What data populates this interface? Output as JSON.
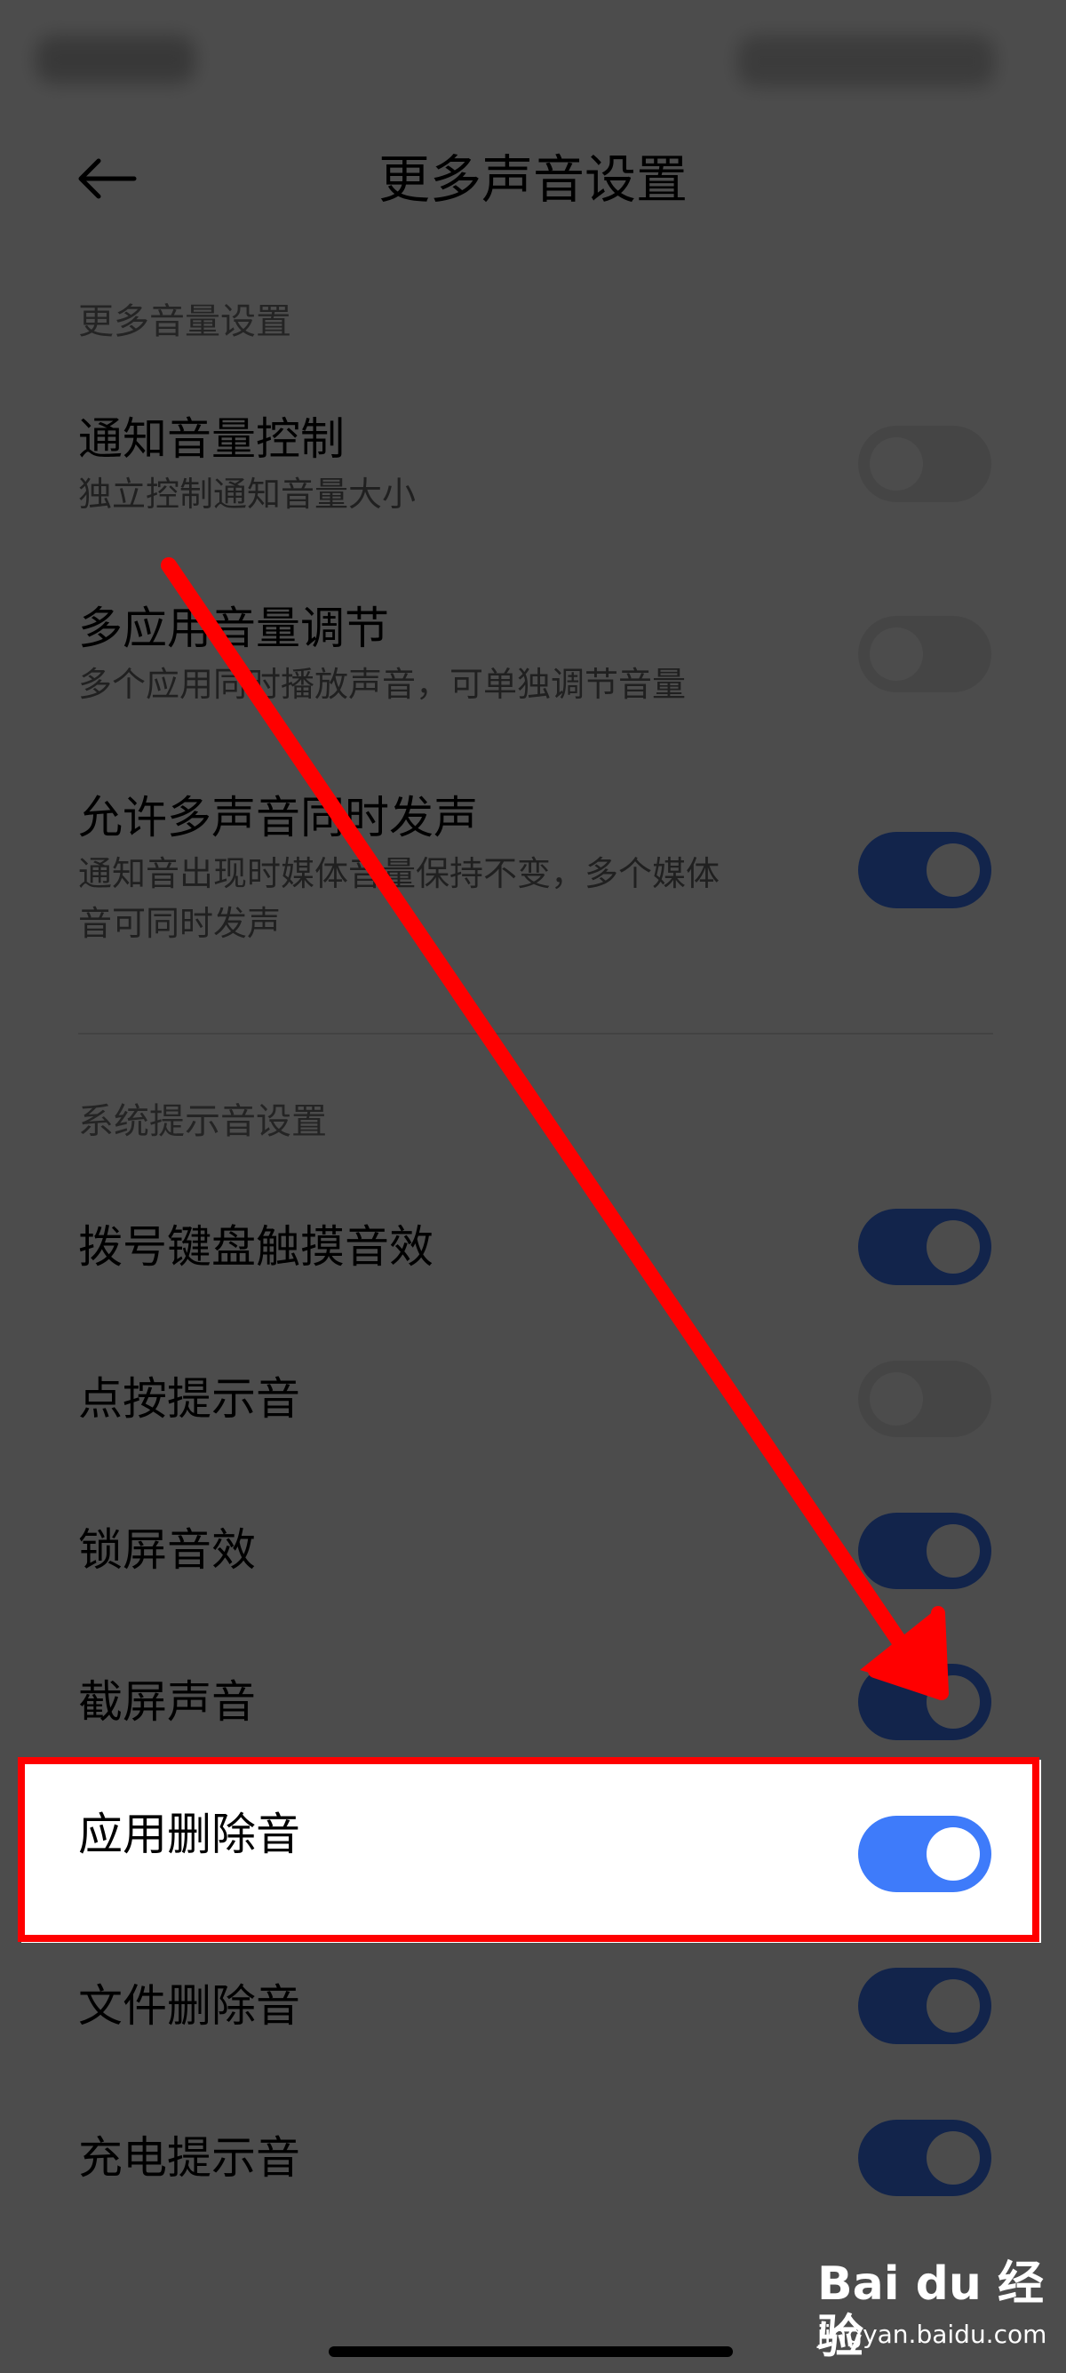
{
  "header": {
    "title": "更多声音设置"
  },
  "sections": {
    "volume": {
      "label": "更多音量设置"
    },
    "system": {
      "label": "系统提示音设置"
    }
  },
  "volume_items": [
    {
      "title": "通知音量控制",
      "subtitle": "独立控制通知音量大小",
      "on": false
    },
    {
      "title": "多应用音量调节",
      "subtitle": "多个应用同时播放声音，可单独调节音量",
      "on": false
    },
    {
      "title": "允许多声音同时发声",
      "subtitle_line1": "通知音出现时媒体音量保持不变，多个媒体",
      "subtitle_line2": "音可同时发声",
      "on": true
    }
  ],
  "system_items": [
    {
      "title": "拨号键盘触摸音效",
      "on": true
    },
    {
      "title": "点按提示音",
      "on": false
    },
    {
      "title": "锁屏音效",
      "on": true
    },
    {
      "title": "截屏声音",
      "on": true
    },
    {
      "title": "应用删除音",
      "on": true
    },
    {
      "title": "文件删除音",
      "on": true
    },
    {
      "title": "充电提示音",
      "on": true
    }
  ],
  "icons": {
    "back": "back-arrow-icon"
  },
  "colors": {
    "toggle_on": "#3e7bfa",
    "toggle_off": "#e6e6e6",
    "annotation": "#ff0000",
    "overlay": "rgba(0,0,0,0.70)"
  },
  "watermark": {
    "brand": "Bai du 经验",
    "url": "jingyan.baidu.com"
  }
}
